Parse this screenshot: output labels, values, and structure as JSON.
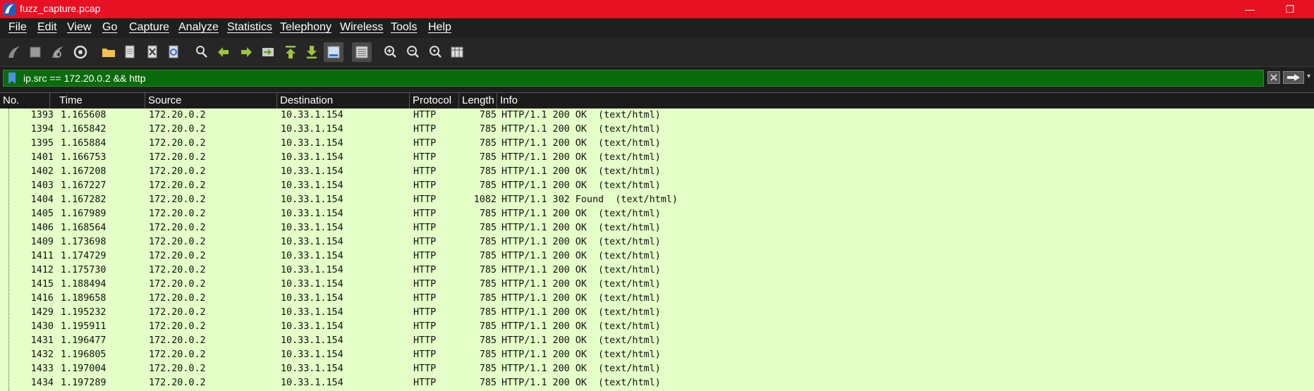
{
  "window": {
    "title": "fuzz_capture.pcap",
    "minimize_label": "—",
    "maximize_label": "❐"
  },
  "menu": [
    "File",
    "Edit",
    "View",
    "Go",
    "Capture",
    "Analyze",
    "Statistics",
    "Telephony",
    "Wireless",
    "Tools",
    "Help"
  ],
  "toolbar": {
    "icons": [
      "shark-fin-start-icon",
      "stop-capture-icon",
      "restart-capture-icon",
      "capture-options-icon",
      "open-file-icon",
      "save-file-icon",
      "close-file-icon",
      "reload-file-icon",
      "find-packet-icon",
      "go-back-icon",
      "go-forward-icon",
      "go-to-packet-icon",
      "go-first-icon",
      "go-last-icon",
      "auto-scroll-icon",
      "colorize-icon",
      "zoom-in-icon",
      "zoom-out-icon",
      "zoom-normal-icon",
      "resize-columns-icon"
    ]
  },
  "filter": {
    "value": "ip.src == 172.20.0.2 && http"
  },
  "columns": [
    "No.",
    "Time",
    "Source",
    "Destination",
    "Protocol",
    "Length",
    "Info"
  ],
  "packets": [
    {
      "no": "1393",
      "time": "1.165608",
      "src": "172.20.0.2",
      "dst": "10.33.1.154",
      "proto": "HTTP",
      "len": "785",
      "info": "HTTP/1.1 200 OK  (text/html)"
    },
    {
      "no": "1394",
      "time": "1.165842",
      "src": "172.20.0.2",
      "dst": "10.33.1.154",
      "proto": "HTTP",
      "len": "785",
      "info": "HTTP/1.1 200 OK  (text/html)"
    },
    {
      "no": "1395",
      "time": "1.165884",
      "src": "172.20.0.2",
      "dst": "10.33.1.154",
      "proto": "HTTP",
      "len": "785",
      "info": "HTTP/1.1 200 OK  (text/html)"
    },
    {
      "no": "1401",
      "time": "1.166753",
      "src": "172.20.0.2",
      "dst": "10.33.1.154",
      "proto": "HTTP",
      "len": "785",
      "info": "HTTP/1.1 200 OK  (text/html)"
    },
    {
      "no": "1402",
      "time": "1.167208",
      "src": "172.20.0.2",
      "dst": "10.33.1.154",
      "proto": "HTTP",
      "len": "785",
      "info": "HTTP/1.1 200 OK  (text/html)"
    },
    {
      "no": "1403",
      "time": "1.167227",
      "src": "172.20.0.2",
      "dst": "10.33.1.154",
      "proto": "HTTP",
      "len": "785",
      "info": "HTTP/1.1 200 OK  (text/html)"
    },
    {
      "no": "1404",
      "time": "1.167282",
      "src": "172.20.0.2",
      "dst": "10.33.1.154",
      "proto": "HTTP",
      "len": "1082",
      "info": "HTTP/1.1 302 Found  (text/html)"
    },
    {
      "no": "1405",
      "time": "1.167989",
      "src": "172.20.0.2",
      "dst": "10.33.1.154",
      "proto": "HTTP",
      "len": "785",
      "info": "HTTP/1.1 200 OK  (text/html)"
    },
    {
      "no": "1406",
      "time": "1.168564",
      "src": "172.20.0.2",
      "dst": "10.33.1.154",
      "proto": "HTTP",
      "len": "785",
      "info": "HTTP/1.1 200 OK  (text/html)"
    },
    {
      "no": "1409",
      "time": "1.173698",
      "src": "172.20.0.2",
      "dst": "10.33.1.154",
      "proto": "HTTP",
      "len": "785",
      "info": "HTTP/1.1 200 OK  (text/html)"
    },
    {
      "no": "1411",
      "time": "1.174729",
      "src": "172.20.0.2",
      "dst": "10.33.1.154",
      "proto": "HTTP",
      "len": "785",
      "info": "HTTP/1.1 200 OK  (text/html)"
    },
    {
      "no": "1412",
      "time": "1.175730",
      "src": "172.20.0.2",
      "dst": "10.33.1.154",
      "proto": "HTTP",
      "len": "785",
      "info": "HTTP/1.1 200 OK  (text/html)"
    },
    {
      "no": "1415",
      "time": "1.188494",
      "src": "172.20.0.2",
      "dst": "10.33.1.154",
      "proto": "HTTP",
      "len": "785",
      "info": "HTTP/1.1 200 OK  (text/html)"
    },
    {
      "no": "1416",
      "time": "1.189658",
      "src": "172.20.0.2",
      "dst": "10.33.1.154",
      "proto": "HTTP",
      "len": "785",
      "info": "HTTP/1.1 200 OK  (text/html)"
    },
    {
      "no": "1429",
      "time": "1.195232",
      "src": "172.20.0.2",
      "dst": "10.33.1.154",
      "proto": "HTTP",
      "len": "785",
      "info": "HTTP/1.1 200 OK  (text/html)"
    },
    {
      "no": "1430",
      "time": "1.195911",
      "src": "172.20.0.2",
      "dst": "10.33.1.154",
      "proto": "HTTP",
      "len": "785",
      "info": "HTTP/1.1 200 OK  (text/html)"
    },
    {
      "no": "1431",
      "time": "1.196477",
      "src": "172.20.0.2",
      "dst": "10.33.1.154",
      "proto": "HTTP",
      "len": "785",
      "info": "HTTP/1.1 200 OK  (text/html)"
    },
    {
      "no": "1432",
      "time": "1.196805",
      "src": "172.20.0.2",
      "dst": "10.33.1.154",
      "proto": "HTTP",
      "len": "785",
      "info": "HTTP/1.1 200 OK  (text/html)"
    },
    {
      "no": "1433",
      "time": "1.197004",
      "src": "172.20.0.2",
      "dst": "10.33.1.154",
      "proto": "HTTP",
      "len": "785",
      "info": "HTTP/1.1 200 OK  (text/html)"
    },
    {
      "no": "1434",
      "time": "1.197289",
      "src": "172.20.0.2",
      "dst": "10.33.1.154",
      "proto": "HTTP",
      "len": "785",
      "info": "HTTP/1.1 200 OK  (text/html)"
    }
  ],
  "colors": {
    "titlebar": "#e81123",
    "filter_valid": "#0a6b0a",
    "row_http": "#e4ffc7"
  }
}
